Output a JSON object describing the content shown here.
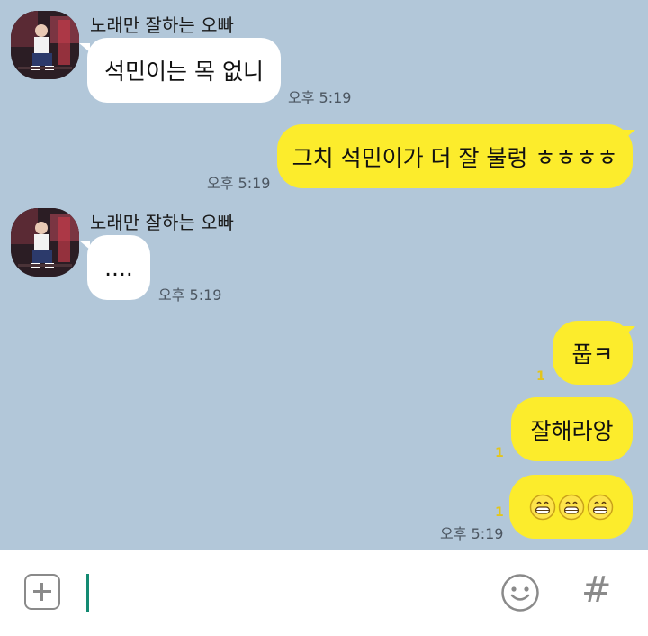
{
  "conversation": {
    "sender_name": "노래만 잘하는 오빠",
    "messages": [
      {
        "text": "석민이는 목 없니",
        "time": "오후 5:19"
      },
      {
        "text": "그치 석민이가 더 잘 불렁 ㅎㅎㅎㅎ",
        "time": "오후 5:19"
      },
      {
        "text": "....",
        "time": "오후 5:19"
      },
      {
        "text": "풉ㅋ",
        "unread": "1"
      },
      {
        "text": "잘해라앙",
        "unread": "1"
      },
      {
        "emoji": "grinning-face x3",
        "unread": "1",
        "time": "오후 5:19"
      }
    ]
  },
  "input_bar": {
    "message_value": "",
    "hash_label": "#"
  },
  "colors": {
    "background": "#b2c7d9",
    "incoming_bubble": "#ffffff",
    "outgoing_bubble": "#fcec2c",
    "unread_count": "#e3c51c",
    "caret": "#138a72"
  }
}
